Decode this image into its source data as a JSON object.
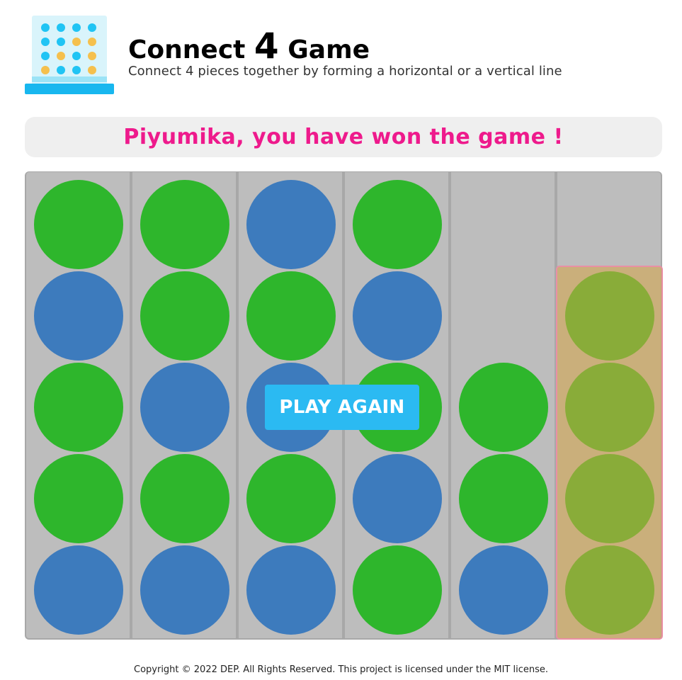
{
  "header": {
    "title_prefix": "Connect ",
    "title_number": "4",
    "title_suffix": " Game",
    "subtitle": "Connect 4 pieces together by forming a horizontal or a vertical line"
  },
  "logo": {
    "icon": "connect-four-grid-icon",
    "colors": {
      "frame": "#d9f4fb",
      "base": "#18b7ef",
      "dot_blue": "#20c4f4",
      "dot_yellow": "#f5c04d"
    }
  },
  "status": {
    "message": "Piyumika, you have won the game !",
    "color": "#ee1a8c"
  },
  "board": {
    "columns": 6,
    "rows": 5,
    "colors": {
      "green": "#2eb62c",
      "blue": "#3d7bbd",
      "empty": "#bdbdbd"
    },
    "cells_top_to_bottom": [
      [
        "green",
        "blue",
        "green",
        "green",
        "blue"
      ],
      [
        "green",
        "green",
        "blue",
        "green",
        "blue"
      ],
      [
        "blue",
        "green",
        "blue",
        "green",
        "blue"
      ],
      [
        "green",
        "blue",
        "green",
        "blue",
        "green"
      ],
      [
        null,
        null,
        "green",
        "green",
        "blue"
      ],
      [
        null,
        "green",
        "green",
        "green",
        "green"
      ]
    ],
    "winning_column": 5
  },
  "play_again": {
    "label": "PLAY AGAIN"
  },
  "footer": {
    "text": "Copyright © 2022 DEP. All Rights Reserved. This project is licensed under the MIT license."
  }
}
